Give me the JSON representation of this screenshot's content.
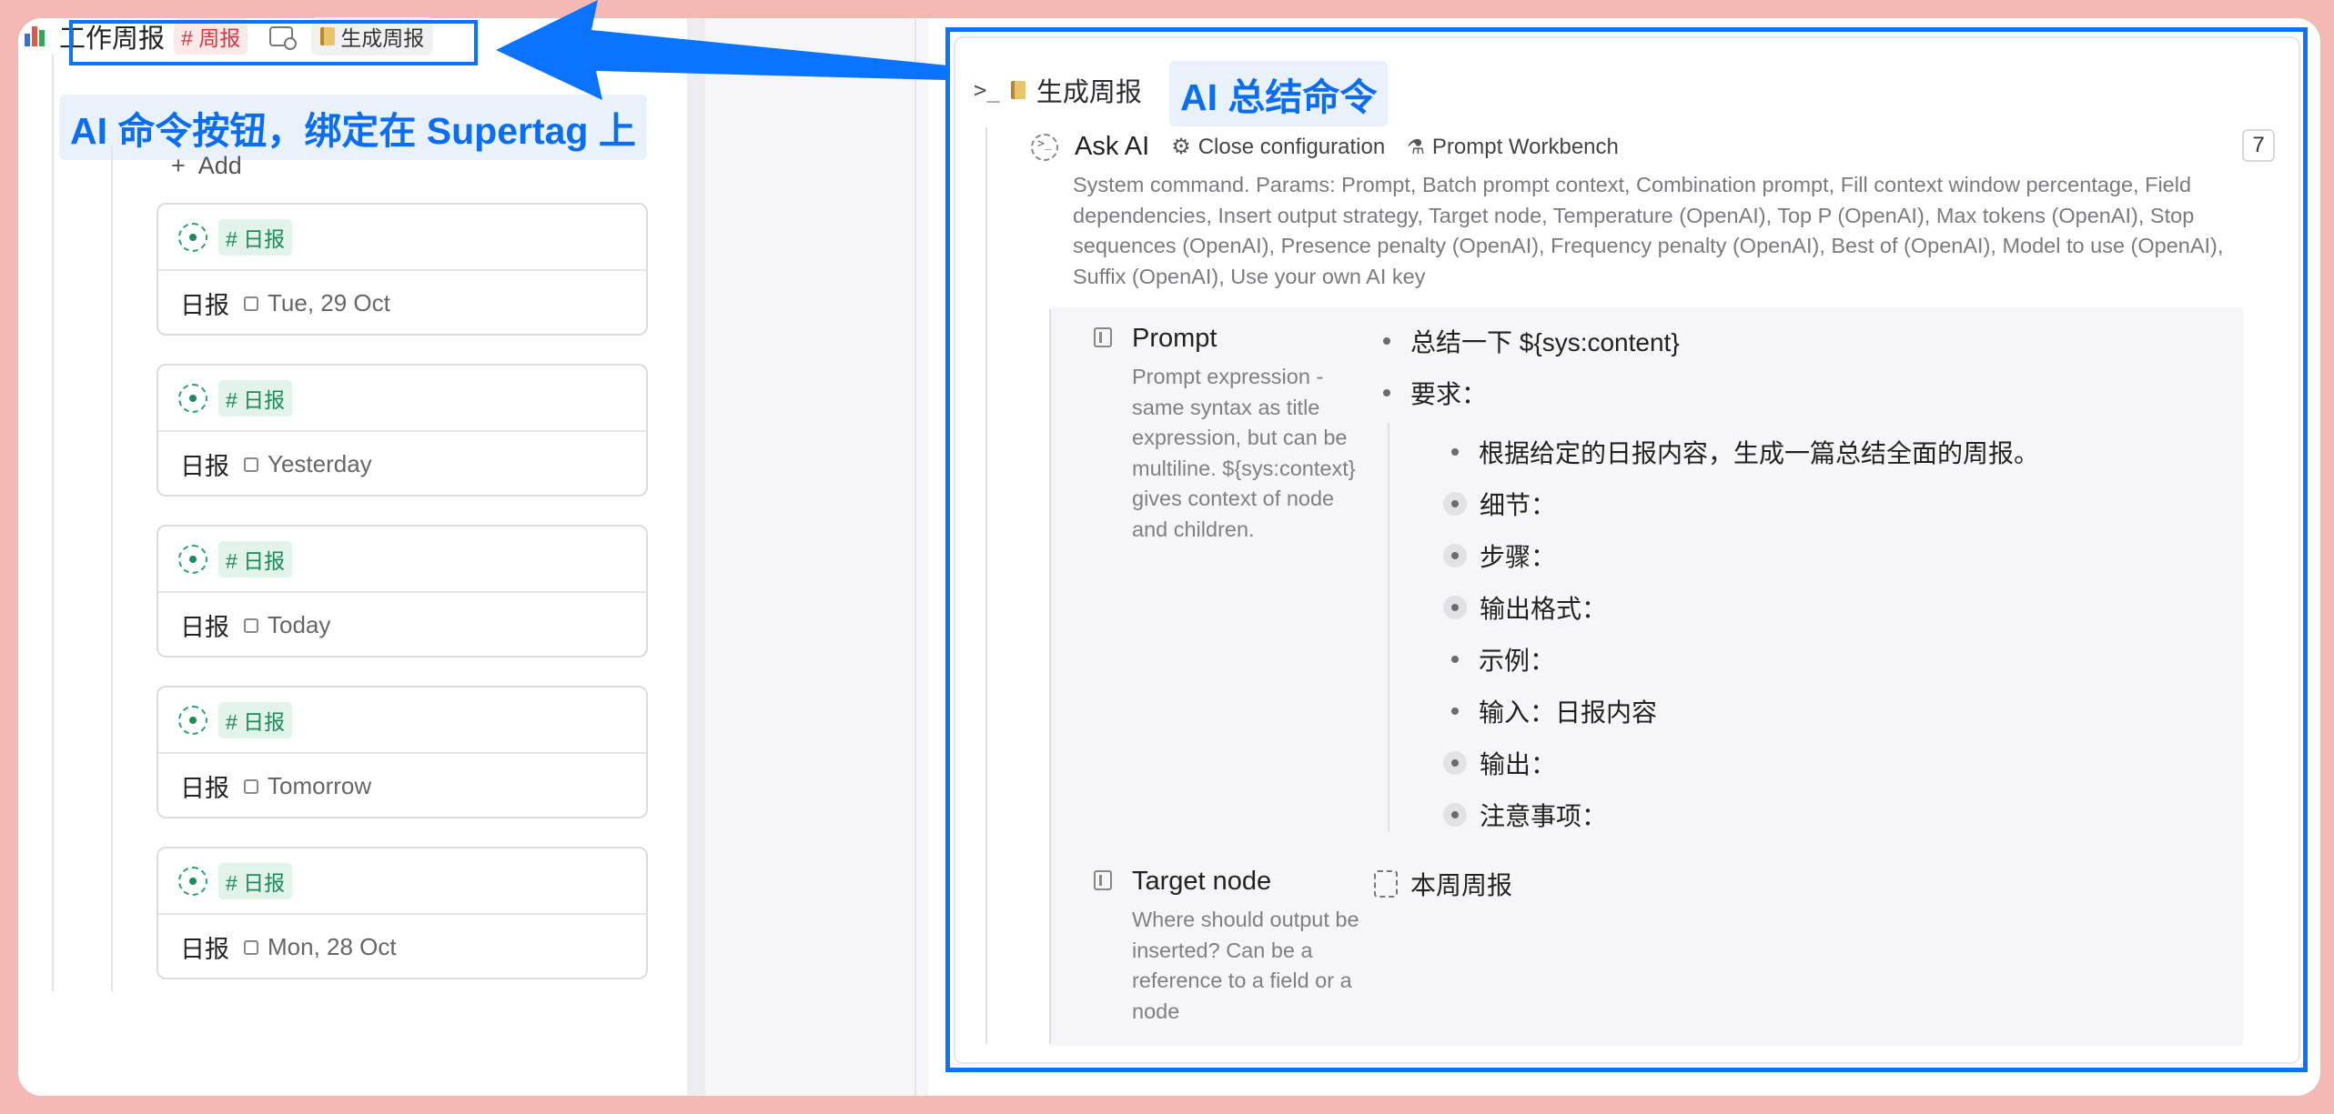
{
  "left": {
    "title": "工作周报",
    "tag": "# 周报",
    "command_button": "生成周报",
    "add_label": "Add",
    "daily_tag": "# 日报",
    "cards": [
      {
        "label": "日报",
        "date": "Tue, 29 Oct"
      },
      {
        "label": "日报",
        "date": "Yesterday"
      },
      {
        "label": "日报",
        "date": "Today"
      },
      {
        "label": "日报",
        "date": "Tomorrow"
      },
      {
        "label": "日报",
        "date": "Mon, 28 Oct"
      }
    ]
  },
  "annotations": {
    "left_callout": "AI 命令按钮，绑定在 Supertag 上",
    "right_callout": "AI 总结命令",
    "accent_color": "#0a73ff"
  },
  "right": {
    "command_name": "生成周报",
    "askai_label": "Ask AI",
    "close_config": "Close configuration",
    "prompt_workbench": "Prompt Workbench",
    "count": "7",
    "description": "System command. Params: Prompt, Batch prompt context, Combination prompt, Fill context window percentage, Field dependencies, Insert output strategy, Target node, Temperature (OpenAI), Top P (OpenAI), Max tokens (OpenAI), Stop sequences (OpenAI), Presence penalty (OpenAI), Frequency penalty (OpenAI), Best of (OpenAI), Model to use (OpenAI), Suffix (OpenAI), Use your own AI key",
    "prompt_field": {
      "title": "Prompt",
      "help": "Prompt expression - same syntax as title expression, but can be multiline. ${sys:context} gives context of node and children.",
      "lines": [
        "总结一下 ${sys:content}",
        "要求：",
        "根据给定的日报内容，生成一篇总结全面的周报。",
        "细节：",
        "步骤：",
        "输出格式：",
        "示例：",
        "输入：日报内容",
        "输出：",
        "注意事项："
      ]
    },
    "target_field": {
      "title": "Target node",
      "help": "Where should output be inserted? Can be a reference to a field or a node",
      "value": "本周周报"
    }
  }
}
